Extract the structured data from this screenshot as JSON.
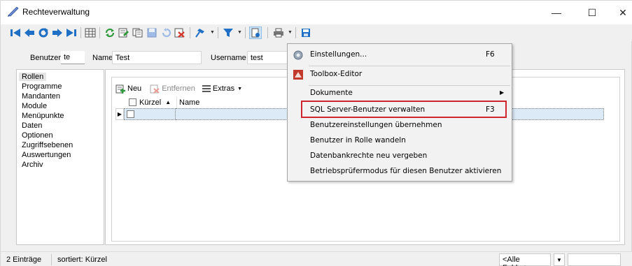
{
  "window": {
    "title": "Rechteverwaltung",
    "controls": {
      "minimize": "—",
      "maximize": "☐",
      "close": "✕"
    }
  },
  "toolbar": {
    "icons": [
      "first-record-icon",
      "previous-record-icon",
      "refresh-icon",
      "next-record-icon",
      "last-record-icon",
      "table-view-icon",
      "reload-icon",
      "edit-record-icon",
      "copy-record-icon",
      "save-icon",
      "undo-icon",
      "delete-icon",
      "pin-icon",
      "filter-icon",
      "info-icon",
      "print-icon",
      "save-disk-icon"
    ]
  },
  "user": {
    "benutzer_label": "Benutzer",
    "benutzer_value": "te",
    "name_label": "Name",
    "name_value": "Test",
    "username_label": "Username",
    "username_value": "test"
  },
  "nav": {
    "items": [
      "Rollen",
      "Programme",
      "Mandanten",
      "Module",
      "Menüpunkte",
      "Daten",
      "Optionen",
      "Zugriffsebenen",
      "Auswertungen",
      "Archiv"
    ],
    "active_index": 0
  },
  "subtoolbar": {
    "new_label": "Neu",
    "remove_label": "Entfernen",
    "extras_label": "Extras"
  },
  "grid": {
    "columns": [
      "Kürzel",
      "Name"
    ],
    "sort_indicator": "▲",
    "row_marker": "▶"
  },
  "statusbar": {
    "count": "2 Einträge",
    "sort": "sortiert: Kürzel",
    "filter_combo": "<Alle Felder>"
  },
  "menu": {
    "items": [
      {
        "label": "Einstellungen...",
        "shortcut": "F6",
        "icon": "settings-gear-icon"
      },
      {
        "label": "Toolbox-Editor",
        "shortcut": "",
        "icon": "toolbox-icon"
      },
      {
        "label": "Dokumente",
        "shortcut": "",
        "submenu": "▶"
      },
      {
        "label": "SQL Server-Benutzer verwalten",
        "shortcut": "F3",
        "highlighted": true
      },
      {
        "label": "Benutzereinstellungen übernehmen",
        "shortcut": ""
      },
      {
        "label": "Benutzer in Rolle wandeln",
        "shortcut": ""
      },
      {
        "label": "Datenbankrechte neu vergeben",
        "shortcut": ""
      },
      {
        "label": "Betriebsprüfermodus für diesen Benutzer aktivieren",
        "shortcut": ""
      }
    ],
    "highlight_color": "#d0242e"
  },
  "colors": {
    "accent_blue": "#1f6fc5",
    "selected_row": "#dceaf8",
    "highlight_red": "#d0242e",
    "delete_red": "#d43a2c",
    "refresh_green": "#2f9a3c"
  }
}
